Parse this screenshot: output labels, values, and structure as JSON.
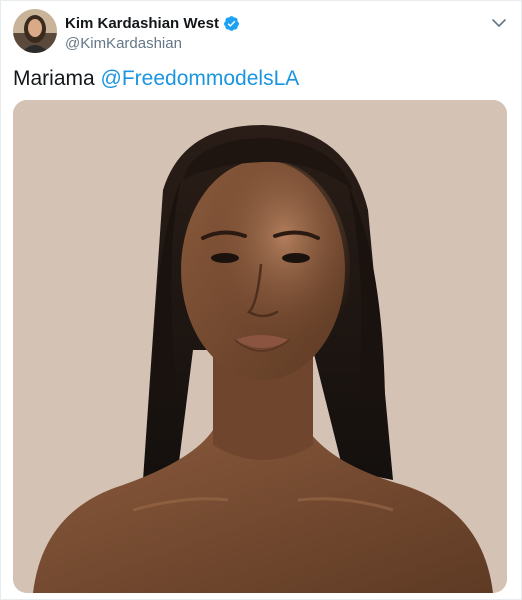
{
  "tweet": {
    "author": {
      "display_name": "Kim Kardashian West",
      "handle": "@KimKardashian",
      "verified": true,
      "avatar_icon": "profile-photo"
    },
    "text": {
      "body": "Mariama",
      "mention": "@FreedommodelsLA"
    },
    "media": {
      "type": "photo",
      "background_color": "#d4c2b5"
    },
    "colors": {
      "link": "#1b95e0",
      "verified_badge": "#1da1f2"
    }
  }
}
